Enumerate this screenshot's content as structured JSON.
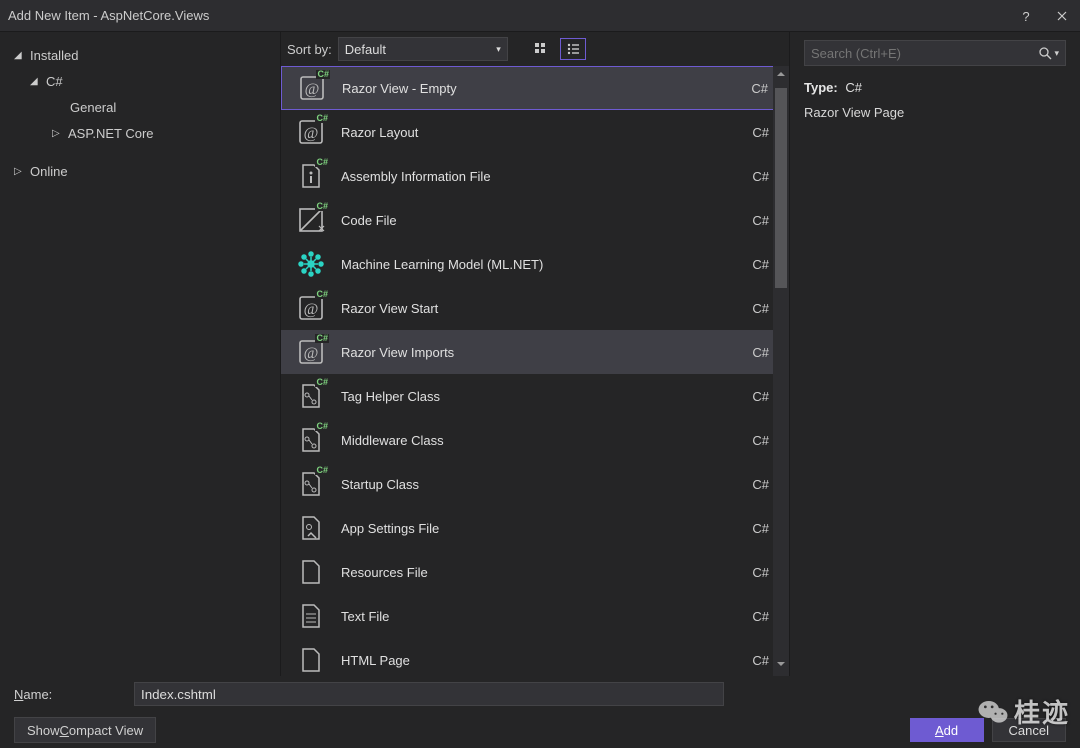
{
  "window": {
    "title": "Add New Item - AspNetCore.Views"
  },
  "sidebar": {
    "items": [
      {
        "label": "Installed",
        "expanded": true,
        "level": 0
      },
      {
        "label": "C#",
        "expanded": true,
        "level": 1
      },
      {
        "label": "General",
        "expanded": false,
        "level": 2,
        "leaf": true
      },
      {
        "label": "ASP.NET Core",
        "expanded": false,
        "level": 2
      },
      {
        "label": "Online",
        "expanded": false,
        "level": 0
      }
    ]
  },
  "sortbar": {
    "label": "Sort by:",
    "value": "Default"
  },
  "templates": {
    "items": [
      {
        "name": "Razor View - Empty",
        "lang": "C#",
        "icon": "razor",
        "selected": true
      },
      {
        "name": "Razor Layout",
        "lang": "C#",
        "icon": "razor"
      },
      {
        "name": "Assembly Information File",
        "lang": "C#",
        "icon": "file-info"
      },
      {
        "name": "Code File",
        "lang": "C#",
        "icon": "code-ext"
      },
      {
        "name": "Machine Learning Model (ML.NET)",
        "lang": "C#",
        "icon": "ml"
      },
      {
        "name": "Razor View Start",
        "lang": "C#",
        "icon": "razor"
      },
      {
        "name": "Razor View Imports",
        "lang": "C#",
        "icon": "razor",
        "hover": true
      },
      {
        "name": "Tag Helper Class",
        "lang": "C#",
        "icon": "tag"
      },
      {
        "name": "Middleware Class",
        "lang": "C#",
        "icon": "mw"
      },
      {
        "name": "Startup Class",
        "lang": "C#",
        "icon": "startup"
      },
      {
        "name": "App Settings File",
        "lang": "C#",
        "icon": "settings"
      },
      {
        "name": "Resources File",
        "lang": "C#",
        "icon": "file"
      },
      {
        "name": "Text File",
        "lang": "C#",
        "icon": "text"
      },
      {
        "name": "HTML Page",
        "lang": "C#",
        "icon": "html"
      }
    ]
  },
  "rightPanel": {
    "search_placeholder": "Search (Ctrl+E)",
    "type_label": "Type:",
    "type_value": "C#",
    "description": "Razor View Page"
  },
  "nameRow": {
    "label": "Name:",
    "value": "Index.cshtml"
  },
  "footer": {
    "compact": "Show Compact View",
    "add": "Add",
    "cancel": "Cancel"
  },
  "watermark": {
    "text": "桂迹"
  }
}
